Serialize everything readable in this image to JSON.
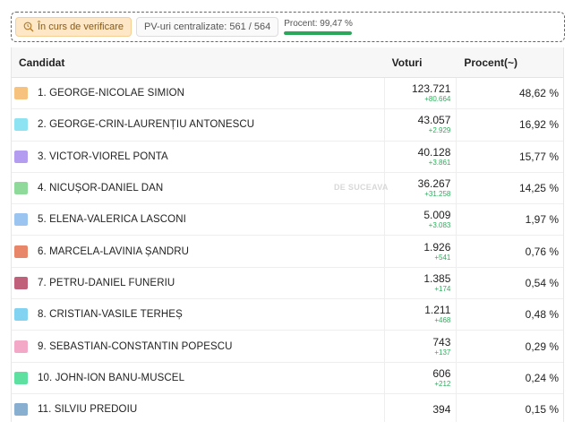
{
  "status": {
    "verification_label": "În curs de verificare",
    "pv_label": "PV-uri centralizate: 561 / 564",
    "progress_label": "Procent: 99,47 %",
    "progress_fraction": 0.9947,
    "colors": {
      "progress_fill": "#2aa85a",
      "verification_bg": "#fde7c7"
    },
    "verification_icon": "clock-search-icon"
  },
  "table": {
    "headers": {
      "candidate": "Candidat",
      "votes": "Voturi",
      "percent": "Procent(~)"
    },
    "rows": [
      {
        "name": "1. GEORGE-NICOLAE SIMION",
        "votes": "123.721",
        "delta": "+80.664",
        "percent": "48,62 %",
        "color": "#f6c27d"
      },
      {
        "name": "2. GEORGE-CRIN-LAURENȚIU ANTONESCU",
        "votes": "43.057",
        "delta": "+2.929",
        "percent": "16,92 %",
        "color": "#8ee3f2"
      },
      {
        "name": "3. VICTOR-VIOREL PONTA",
        "votes": "40.128",
        "delta": "+3.861",
        "percent": "15,77 %",
        "color": "#b49cf0"
      },
      {
        "name": "4. NICUȘOR-DANIEL DAN",
        "votes": "36.267",
        "delta": "+31.258",
        "percent": "14,25 %",
        "color": "#8fd99a"
      },
      {
        "name": "5. ELENA-VALERICA LASCONI",
        "votes": "5.009",
        "delta": "+3.083",
        "percent": "1,97 %",
        "color": "#9cc4f0"
      },
      {
        "name": "6. MARCELA-LAVINIA ȘANDRU",
        "votes": "1.926",
        "delta": "+541",
        "percent": "0,76 %",
        "color": "#e8866a"
      },
      {
        "name": "7. PETRU-DANIEL FUNERIU",
        "votes": "1.385",
        "delta": "+174",
        "percent": "0,54 %",
        "color": "#c0607a"
      },
      {
        "name": "8. CRISTIAN-VASILE TERHEȘ",
        "votes": "1.211",
        "delta": "+468",
        "percent": "0,48 %",
        "color": "#82d2f2"
      },
      {
        "name": "9. SEBASTIAN-CONSTANTIN POPESCU",
        "votes": "743",
        "delta": "+137",
        "percent": "0,29 %",
        "color": "#f4a8c8"
      },
      {
        "name": "10. JOHN-ION BANU-MUSCEL",
        "votes": "606",
        "delta": "+212",
        "percent": "0,24 %",
        "color": "#5ee0a0"
      },
      {
        "name": "11. SILVIU PREDOIU",
        "votes": "394",
        "delta": "",
        "percent": "0,15 %",
        "color": "#88aed0"
      }
    ]
  },
  "watermark": "DE SUCEAVA"
}
